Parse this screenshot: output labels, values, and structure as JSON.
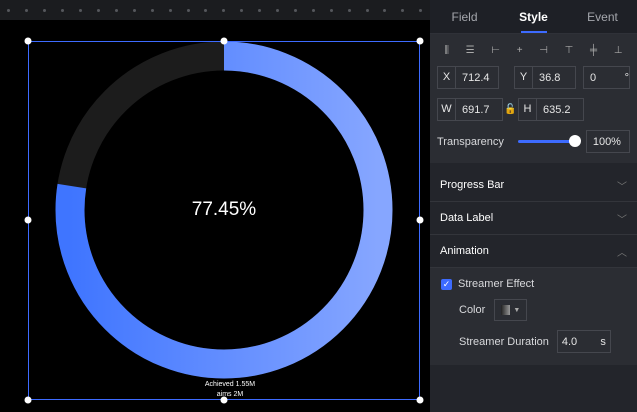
{
  "chart": {
    "value_label": "77.45%",
    "progress": 0.7745,
    "achieved": "Achieved 1.55M",
    "aims": "aims 2M",
    "colors": {
      "progress": "#4a7dff",
      "track": "#1c1c1c"
    }
  },
  "tabs": [
    {
      "label": "Field"
    },
    {
      "label": "Style"
    },
    {
      "label": "Event"
    }
  ],
  "position": {
    "x_label": "X",
    "x": "712.4",
    "y_label": "Y",
    "y": "36.8",
    "rotation": "0",
    "rotation_unit": "°",
    "w_label": "W",
    "w": "691.7",
    "h_label": "H",
    "h": "635.2"
  },
  "transparency": {
    "label": "Transparency",
    "value": "100%",
    "fraction": 1.0
  },
  "sections": {
    "progress_bar": "Progress Bar",
    "data_label": "Data Label",
    "animation": "Animation"
  },
  "animation": {
    "streamer_effect": "Streamer Effect",
    "checked": true,
    "color_label": "Color",
    "duration_label": "Streamer Duration",
    "duration": "4.0",
    "duration_unit": "s"
  }
}
